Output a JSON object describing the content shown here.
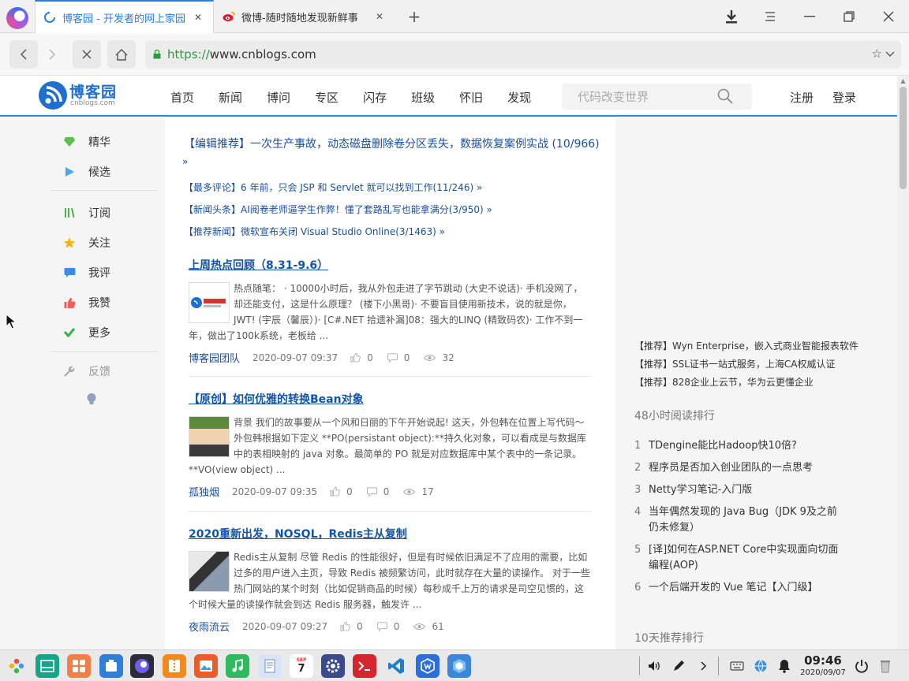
{
  "browser": {
    "tabs": [
      {
        "title": "博客园 - 开发者的网上家园",
        "active": true
      },
      {
        "title": "微博-随时随地发现新鲜事",
        "active": false
      }
    ],
    "new_tab": "+",
    "url_scheme": "https://",
    "url_host": "www.cnblogs.com"
  },
  "site": {
    "logo_text": "博客园",
    "logo_sub": "cnblogs.com",
    "nav": [
      "首页",
      "新闻",
      "博问",
      "专区",
      "闪存",
      "班级",
      "怀旧",
      "发现"
    ],
    "search_placeholder": "代码改变世界",
    "register": "注册",
    "login": "登录"
  },
  "left_menu": {
    "group1": [
      "精华",
      "候选"
    ],
    "group2": [
      "订阅",
      "关注",
      "我评",
      "我赞",
      "更多"
    ],
    "feedback": "反馈"
  },
  "promos": [
    "【编辑推荐】一次生产事故，动态磁盘删除卷分区丢失，数据恢复案例实战 (10/966)",
    "»",
    "【最多评论】6 年前，只会 JSP 和 Servlet 就可以找到工作(11/246) »",
    "【新闻头条】AI阅卷老师逼学生作弊！懂了套路乱写也能拿满分(3/950) »",
    "【推荐新闻】微软宣布关闭 Visual Studio Online(3/1463) »"
  ],
  "posts": [
    {
      "title": "上周热点回顾（8.31-9.6）",
      "summary": "热点随笔： · 10000小时后，我从外包走进了字节跳动 (大史不说话)· 手机没网了，却还能支付，这是什么原理？ (楼下小黑哥)· 不要盲目使用新技术，说的就是你，JWT! (宇辰（馨辰）)· [C#.NET 拾遗补漏]08：强大的LINQ (精致码农)· 工作不到一年，做出了100k系统，老板给 ...",
      "author": "博客园团队",
      "date": "2020-09-07 09:37",
      "likes": "0",
      "comments": "0",
      "views": "32"
    },
    {
      "title": "【原创】如何优雅的转换Bean对象",
      "summary": "背景 我们的故事要从一个风和日丽的下午开始说起! 这天，外包韩在位置上写代码～外包韩根据如下定义 **PO(persistant object):**持久化对象，可以看成是与数据库中的表相映射的 java 对象。最简单的 PO 就是对应数据库中某个表中的一条记录。 **VO(view object) ...",
      "author": "孤独烟",
      "date": "2020-09-07 09:35",
      "likes": "0",
      "comments": "0",
      "views": "17"
    },
    {
      "title": "2020重新出发，NOSQL，Redis主从复制",
      "summary": "Redis主从复制 尽管 Redis 的性能很好，但是有时候依旧满足不了应用的需要，比如过多的用户进入主页，导致 Redis 被频繁访问，此时就存在大量的读操作。 对于一些热门网站的某个时刻（比如促销商品的时候）每秒成千上万的请求是司空见惯的，这个时候大量的读操作就会到达 Redis 服务器，触发许 ...",
      "author": "夜雨流云",
      "date": "2020-09-07 09:27",
      "likes": "0",
      "comments": "0",
      "views": "61"
    }
  ],
  "right": {
    "ads": [
      "【推荐】Wyn Enterprise，嵌入式商业智能报表软件",
      "【推荐】SSL证书一站式服务，上海CA权威认证",
      "【推荐】828企业上云节，华为云更懂企业"
    ],
    "reading_rank_title": "48小时阅读排行",
    "reading_rank": [
      {
        "num": "1",
        "text": "TDengine能比Hadoop快10倍?"
      },
      {
        "num": "2",
        "text": "程序员是否加入创业团队的一点思考"
      },
      {
        "num": "3",
        "text": "Netty学习笔记-入门版"
      },
      {
        "num": "4",
        "text": "当年偶然发现的 Java Bug（JDK 9及之前仍未修复）"
      },
      {
        "num": "5",
        "text": "[译]如何在ASP.NET Core中实现面向切面编程(AOP)"
      },
      {
        "num": "6",
        "text": "一个后端开发的 Vue 笔记【入门级】"
      }
    ],
    "recommend_rank_title": "10天推荐排行"
  },
  "taskbar": {
    "time": "09:46",
    "date": "2020/09/07",
    "calendar_month": "SEP",
    "calendar_day": "7"
  },
  "colors": {
    "accent": "#2b7de9",
    "site_blue": "#1e6fd0",
    "link": "#1255a8"
  }
}
